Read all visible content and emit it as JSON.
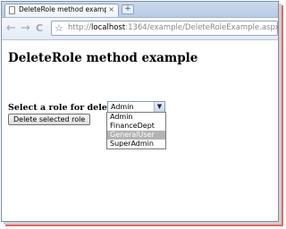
{
  "browser": {
    "tab_title": "DeleteRole method exampl...",
    "tab_close": "×",
    "new_tab": "+",
    "back": "←",
    "forward": "→",
    "reload": "C",
    "star": "☆",
    "url_scheme": "http://",
    "url_host": "localhost",
    "url_rest": ":1364/example/DeleteRoleExample.aspx"
  },
  "page": {
    "heading": "DeleteRole method example",
    "prompt": "Select a role for delete it.",
    "select_value": "Admin",
    "delete_button": "Delete selected role",
    "options": [
      "Admin",
      "FinanceDept",
      "GeneralUser",
      "SuperAdmin"
    ],
    "highlighted_option": "GeneralUser"
  }
}
